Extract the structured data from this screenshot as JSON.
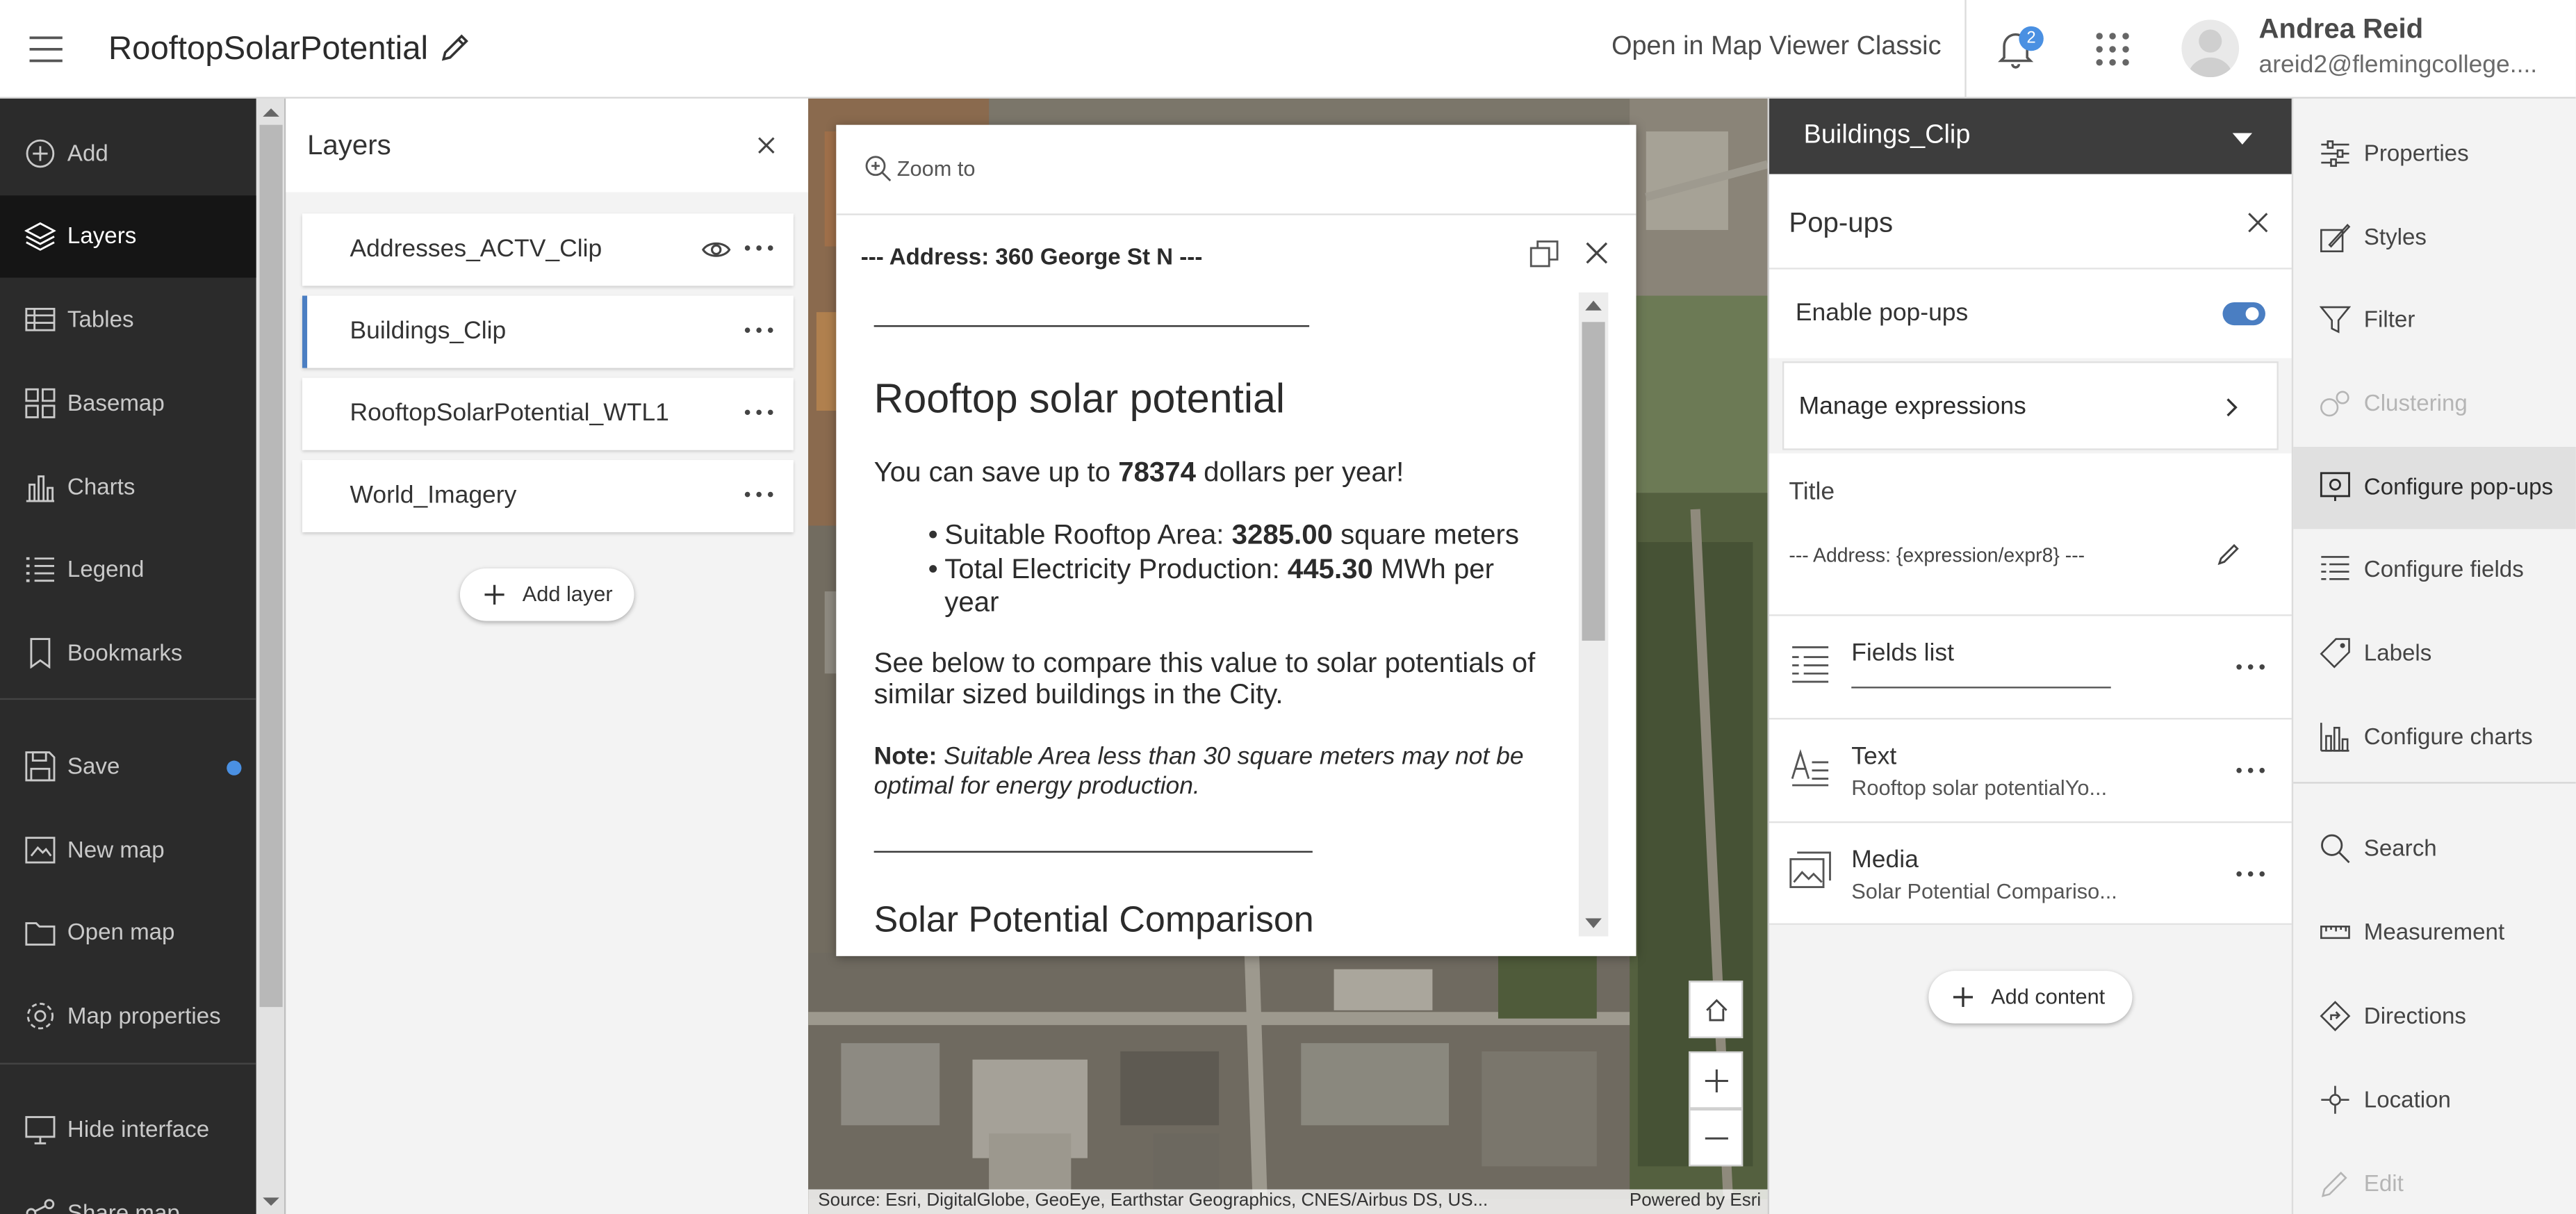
{
  "header": {
    "title": "RooftopSolarPotential",
    "open_classic": "Open in Map Viewer Classic",
    "notification_count": "2",
    "user_name": "Andrea Reid",
    "user_email": "areid2@flemingcollege...."
  },
  "nav": {
    "items": [
      {
        "label": "Add",
        "icon": "add-circle-icon"
      },
      {
        "label": "Layers",
        "icon": "layers-icon",
        "active": true
      },
      {
        "label": "Tables",
        "icon": "table-icon"
      },
      {
        "label": "Basemap",
        "icon": "basemap-icon"
      },
      {
        "label": "Charts",
        "icon": "chart-icon"
      },
      {
        "label": "Legend",
        "icon": "legend-icon"
      },
      {
        "label": "Bookmarks",
        "icon": "bookmark-icon"
      },
      {
        "label": "Save",
        "icon": "save-icon"
      },
      {
        "label": "New map",
        "icon": "new-map-icon"
      },
      {
        "label": "Open map",
        "icon": "folder-icon"
      },
      {
        "label": "Map properties",
        "icon": "gear-icon"
      },
      {
        "label": "Hide interface",
        "icon": "monitor-icon"
      },
      {
        "label": "Share map",
        "icon": "share-icon"
      }
    ]
  },
  "layers_panel": {
    "title": "Layers",
    "layers": [
      {
        "name": "Addresses_ACTV_Clip"
      },
      {
        "name": "Buildings_Clip",
        "selected": true
      },
      {
        "name": "RooftopSolarPotential_WTL1"
      },
      {
        "name": "World_Imagery"
      }
    ],
    "add_layer": "Add layer"
  },
  "popup": {
    "zoom_to": "Zoom to",
    "title": "--- Address: 360 George St N ---",
    "heading": "Rooftop solar potential",
    "savings_prefix": "You can save up to ",
    "savings_value": "78374",
    "savings_suffix": " dollars per year!",
    "area_label": "Suitable Rooftop Area: ",
    "area_value": "3285.00",
    "area_unit": " square meters",
    "prod_label": "Total Electricity Production: ",
    "prod_value": "445.30",
    "prod_unit_1": " MWh per",
    "prod_unit_2": "year",
    "compare_line1": "See below to compare this value to solar potentials of",
    "compare_line2": "similar sized buildings in the City.",
    "note_label": "Note:",
    "note_line1": " Suitable Area less than 30 square meters may not be",
    "note_line2": "optimal for energy production.",
    "heading2": "Solar Potential Comparison"
  },
  "map": {
    "attribution": "Source: Esri, DigitalGlobe, GeoEye, Earthstar Geographics, CNES/Airbus DS, US...",
    "powered": "Powered by Esri"
  },
  "config": {
    "layer_name": "Buildings_Clip",
    "panel_title": "Pop-ups",
    "enable_label": "Enable pop-ups",
    "enable_on": true,
    "manage_expressions": "Manage expressions",
    "title_label": "Title",
    "title_value": "--- Address: {expression/expr8} ---",
    "elements": [
      {
        "name": "Fields list",
        "sub": "",
        "icon": "fields-list-icon"
      },
      {
        "name": "Text",
        "sub": "Rooftop solar potentialYo...",
        "icon": "text-icon"
      },
      {
        "name": "Media",
        "sub": "Solar Potential Compariso...",
        "icon": "media-icon"
      }
    ],
    "add_content": "Add content"
  },
  "right_toolbar": {
    "items": [
      {
        "label": "Properties",
        "icon": "sliders-icon"
      },
      {
        "label": "Styles",
        "icon": "styles-icon"
      },
      {
        "label": "Filter",
        "icon": "filter-icon"
      },
      {
        "label": "Clustering",
        "icon": "clustering-icon",
        "disabled": true
      },
      {
        "label": "Configure pop-ups",
        "icon": "popup-icon",
        "active": true
      },
      {
        "label": "Configure fields",
        "icon": "fields-icon"
      },
      {
        "label": "Labels",
        "icon": "label-icon"
      },
      {
        "label": "Configure charts",
        "icon": "charts-icon"
      },
      {
        "label": "Search",
        "icon": "search-icon"
      },
      {
        "label": "Measurement",
        "icon": "ruler-icon"
      },
      {
        "label": "Directions",
        "icon": "directions-icon"
      },
      {
        "label": "Location",
        "icon": "location-icon"
      },
      {
        "label": "Edit",
        "icon": "edit-icon",
        "disabled": true
      }
    ]
  },
  "colors": {
    "accent": "#4a7ec2",
    "nav_bg": "#2b2b2b",
    "badge": "#4a90e2"
  }
}
